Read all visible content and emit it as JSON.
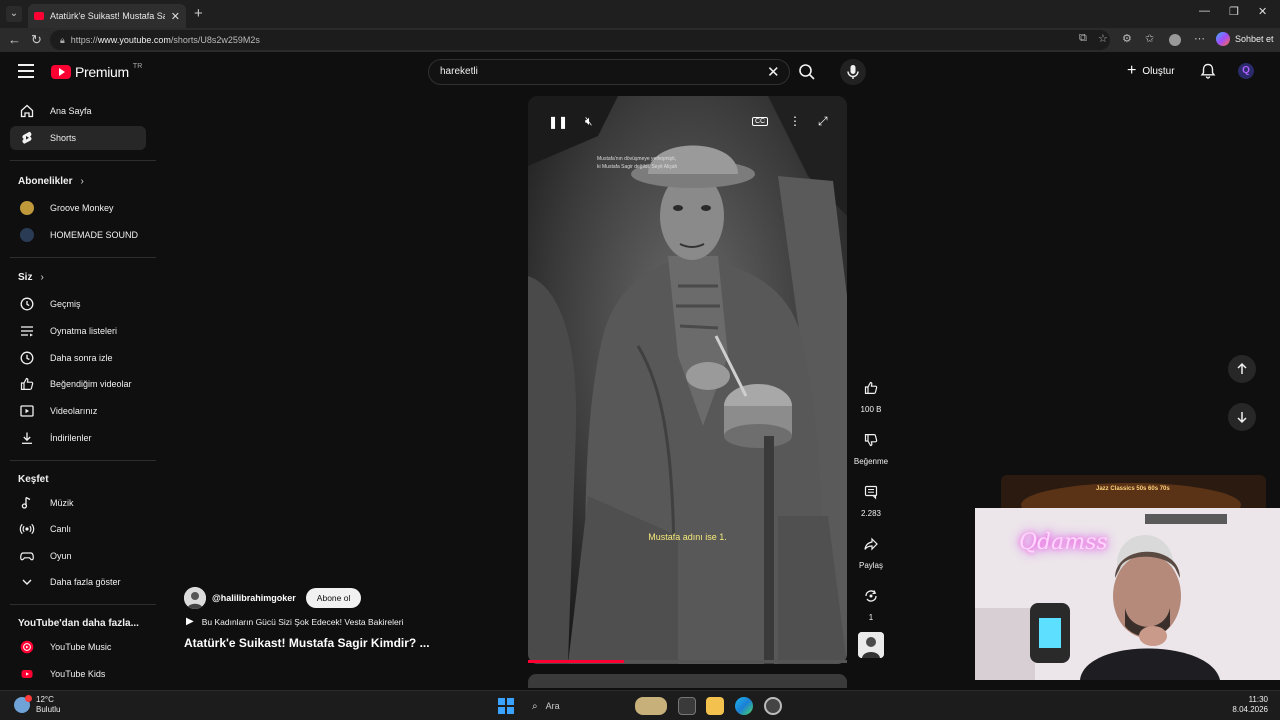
{
  "browser": {
    "tab_title": "Atatürk'e Suikast! Mustafa Sagir K",
    "url_prefix": "https://",
    "url_host": "www.youtube.com",
    "url_path": "/shorts/U8s2w259M2s",
    "copilot_label": "Sohbet et"
  },
  "header": {
    "logo_text": "Premium",
    "region": "TR",
    "search_value": "hareketli",
    "create_label": "Oluştur",
    "avatar_letter": "Q"
  },
  "sidebar": {
    "main": [
      {
        "label": "Ana Sayfa",
        "icon": "home-icon"
      },
      {
        "label": "Shorts",
        "icon": "shorts-icon"
      }
    ],
    "subs_heading": "Abonelikler",
    "subs": [
      {
        "label": "Groove Monkey",
        "color": "#c09a3a"
      },
      {
        "label": "HOMEMADE SOUND",
        "color": "#2a3b55"
      }
    ],
    "you_heading": "Siz",
    "you": [
      {
        "label": "Geçmiş",
        "icon": "history-icon"
      },
      {
        "label": "Oynatma listeleri",
        "icon": "playlists-icon"
      },
      {
        "label": "Daha sonra izle",
        "icon": "watch-later-icon"
      },
      {
        "label": "Beğendiğim videolar",
        "icon": "like-icon"
      },
      {
        "label": "Videolarınız",
        "icon": "your-videos-icon"
      },
      {
        "label": "İndirilenler",
        "icon": "download-icon"
      }
    ],
    "explore_heading": "Keşfet",
    "explore": [
      {
        "label": "Müzik",
        "icon": "music-icon"
      },
      {
        "label": "Canlı",
        "icon": "live-icon"
      },
      {
        "label": "Oyun",
        "icon": "gaming-icon"
      },
      {
        "label": "Daha fazla göster",
        "icon": "chevron-down-icon"
      }
    ],
    "more_heading": "YouTube'dan daha fazla...",
    "more": [
      {
        "label": "YouTube Music"
      },
      {
        "label": "YouTube Kids"
      }
    ]
  },
  "short": {
    "caption": "Mustafa adını ise 1.",
    "overlay_text_1": "Mustafa'nın dövüşmeye yerleşmişti,",
    "overlay_text_2": "ki Mustafa Sagir değildi. Seyit Alişah",
    "progress": 0.3,
    "channel": "@halilibrahimgoker",
    "subscribe_label": "Abone ol",
    "playlist_text": "Bu Kadınların Gücü Sizi Şok Edecek! Vesta Bakireleri",
    "title": "Atatürk'e Suikast! Mustafa Sagir Kimdir? ..."
  },
  "actions": {
    "like_count": "100 B",
    "dislike_label": "Beğenme",
    "comment_count": "2.283",
    "share_label": "Paylaş",
    "remix_count": "1"
  },
  "overlay": {
    "banner_text": "Jazz Classics 50s 60s 70s",
    "neon_text": "Qdamss"
  },
  "taskbar": {
    "temp": "12°C",
    "weather": "Bulutlu",
    "search_label": "Ara",
    "time": "11:30",
    "date": "8.04.2026"
  }
}
